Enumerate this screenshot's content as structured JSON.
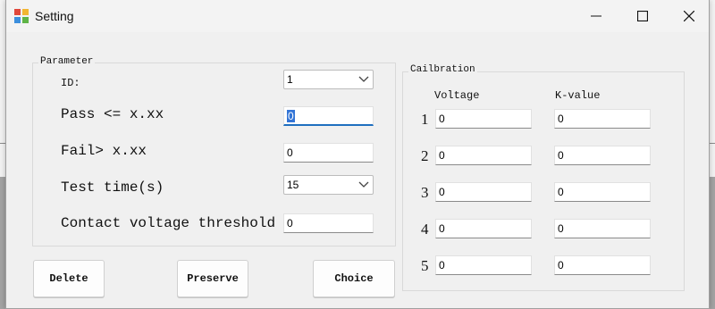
{
  "window": {
    "title": "Setting"
  },
  "parameter": {
    "legend": "Parameter",
    "id_label": "ID:",
    "id_value": "1",
    "pass_label": "Pass <= x.xx",
    "pass_value": "0",
    "fail_label": "Fail>  x.xx",
    "fail_value": "0",
    "test_time_label": "Test time(s)",
    "test_time_value": "15",
    "contact_label": "Contact voltage threshold",
    "contact_value": "0"
  },
  "buttons": {
    "delete": "Delete",
    "preserve": "Preserve",
    "choice": "Choice"
  },
  "calibration": {
    "legend": "Cailbration",
    "voltage_header": "Voltage",
    "kvalue_header": "K-value",
    "rows": [
      {
        "num": "1",
        "voltage": "0",
        "kvalue": "0"
      },
      {
        "num": "2",
        "voltage": "0",
        "kvalue": "0"
      },
      {
        "num": "3",
        "voltage": "0",
        "kvalue": "0"
      },
      {
        "num": "4",
        "voltage": "0",
        "kvalue": "0"
      },
      {
        "num": "5",
        "voltage": "0",
        "kvalue": "0"
      }
    ]
  },
  "colors": {
    "focus_accent": "#1f6fbf",
    "selection": "#3375d6",
    "window_bg": "#f0f0f0"
  },
  "icons": {
    "app": "app-icon",
    "minimize": "minimize-icon",
    "maximize": "maximize-icon",
    "close": "close-icon",
    "dropdown": "chevron-down-icon"
  }
}
